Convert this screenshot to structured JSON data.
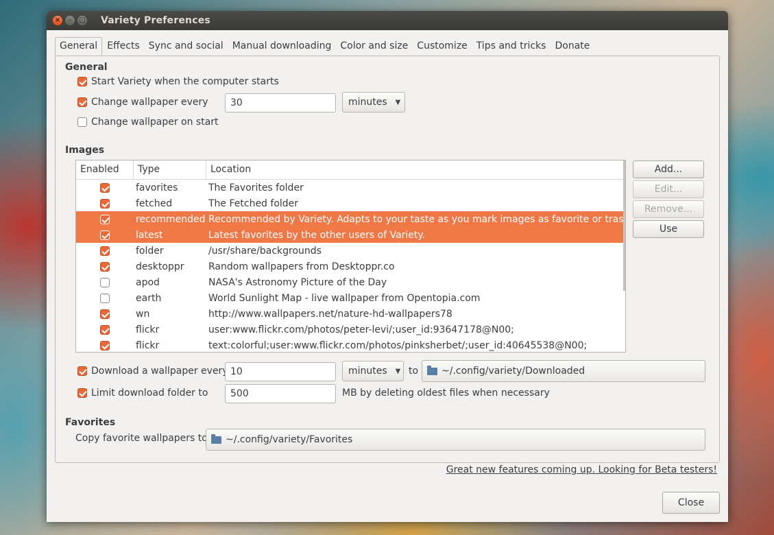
{
  "window": {
    "title": "Variety Preferences"
  },
  "tabs": [
    "General",
    "Effects",
    "Sync and social",
    "Manual downloading",
    "Color and size",
    "Customize",
    "Tips and tricks",
    "Donate"
  ],
  "general": {
    "heading": "General",
    "start_on_boot": {
      "label": "Start Variety when the computer starts",
      "checked": true
    },
    "change_every": {
      "label": "Change wallpaper every",
      "checked": true,
      "value": "30",
      "unit": "minutes"
    },
    "change_on_start": {
      "label": "Change wallpaper on start",
      "checked": false
    }
  },
  "images": {
    "heading": "Images",
    "columns": [
      "Enabled",
      "Type",
      "Location"
    ],
    "rows": [
      {
        "enabled": true,
        "type": "favorites",
        "location": "The Favorites folder",
        "selected": false
      },
      {
        "enabled": true,
        "type": "fetched",
        "location": "The Fetched folder",
        "selected": false
      },
      {
        "enabled": true,
        "type": "recommended",
        "location": "Recommended by Variety. Adapts to your taste as you mark images as favorite or trash.",
        "selected": true
      },
      {
        "enabled": true,
        "type": "latest",
        "location": "Latest favorites by the other users of Variety.",
        "selected": true
      },
      {
        "enabled": true,
        "type": "folder",
        "location": "/usr/share/backgrounds",
        "selected": false
      },
      {
        "enabled": true,
        "type": "desktoppr",
        "location": "Random wallpapers from Desktoppr.co",
        "selected": false
      },
      {
        "enabled": false,
        "type": "apod",
        "location": "NASA's Astronomy Picture of the Day",
        "selected": false
      },
      {
        "enabled": false,
        "type": "earth",
        "location": "World Sunlight Map - live wallpaper from Opentopia.com",
        "selected": false
      },
      {
        "enabled": true,
        "type": "wn",
        "location": "http://www.wallpapers.net/nature-hd-wallpapers78",
        "selected": false
      },
      {
        "enabled": true,
        "type": "flickr",
        "location": "user:www.flickr.com/photos/peter-levi/;user_id:93647178@N00;",
        "selected": false
      },
      {
        "enabled": true,
        "type": "flickr",
        "location": "text:colorful;user:www.flickr.com/photos/pinksherbet/;user_id:40645538@N00;",
        "selected": false
      }
    ],
    "buttons": {
      "add": "Add...",
      "edit": "Edit...",
      "remove": "Remove...",
      "use": "Use"
    }
  },
  "download": {
    "label": "Download a wallpaper every",
    "checked": true,
    "value": "10",
    "unit": "minutes",
    "to_label": "to",
    "folder": "~/.config/variety/Downloaded"
  },
  "limit": {
    "label": "Limit download folder to",
    "checked": true,
    "value": "500",
    "suffix": "MB by deleting oldest files when necessary"
  },
  "favorites": {
    "heading": "Favorites",
    "copy_label": "Copy favorite wallpapers to",
    "folder": "~/.config/variety/Favorites"
  },
  "beta_link": "Great new features coming up. Looking for Beta testers!",
  "close_button": "Close",
  "colors": {
    "accent": "#f07746",
    "checkbox": "#e86a3a",
    "titlebar": "#3c3b37"
  },
  "icons": {
    "close": "close-icon",
    "minimize": "minimize-icon",
    "maximize": "maximize-icon",
    "folder": "folder-icon",
    "dropdown": "chevron-down-icon"
  }
}
